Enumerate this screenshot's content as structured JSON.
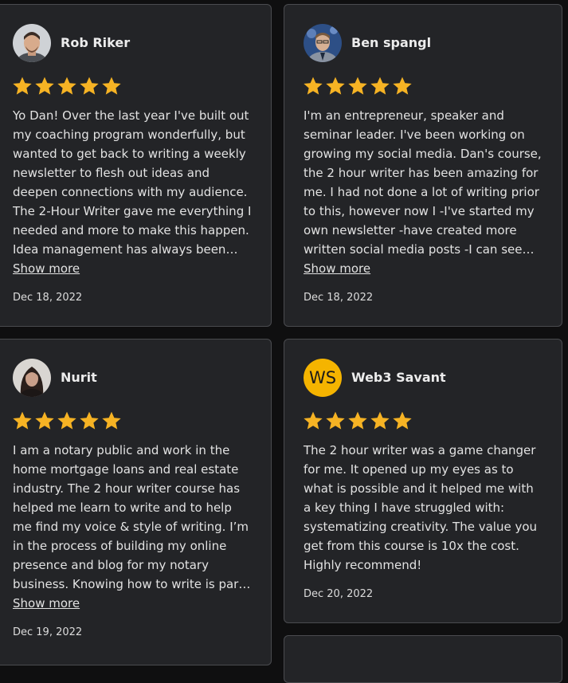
{
  "reviews": [
    {
      "name": "Rob Riker",
      "avatar": "person-photo",
      "rating": 5,
      "text": "Yo Dan! Over the last year I've built out my coaching program wonderfully, but wanted to get back to writing a weekly newsletter to flesh out ideas and deepen connections with my audience. The 2-Hour Writer gave me everything I needed and more to make this happen. Idea management has always been tough for me...",
      "show_more": "Show more",
      "date": "Dec 18, 2022"
    },
    {
      "name": "Ben spangl",
      "avatar": "person-photo",
      "rating": 5,
      "text": "I'm an entrepreneur, speaker and seminar leader. I've been working on growing my social media. Dan's course, the 2 hour writer has been amazing for me. I had not done a lot of writing prior to this, however now I -I've started my own newsletter -have created more written social media posts -I can see how...",
      "show_more": "Show more",
      "date": "Dec 18, 2022"
    },
    {
      "name": "Nurit",
      "avatar": "person-photo",
      "rating": 5,
      "text": "I am a notary public and work in the home mortgage loans and real estate industry. The 2 hour writer course has helped me learn to write and to help me find my voice & style of writing. I’m in the process of building my online presence and blog for my notary business. Knowing how to write is part of that....",
      "show_more": "Show more",
      "date": "Dec 19, 2022"
    },
    {
      "name": "Web3 Savant",
      "avatar_initials": "WS",
      "avatar_color": "#f5b400",
      "rating": 5,
      "text": "The 2 hour writer was a game changer for me. It opened up my eyes as to what is possible and it helped me with a key thing I have struggled with: systematizing creativity. The value you get from this course is 10x the cost. Highly recommend!",
      "date": "Dec 20, 2022"
    }
  ],
  "star_color": "#f6b324",
  "star_icon": "star-icon"
}
